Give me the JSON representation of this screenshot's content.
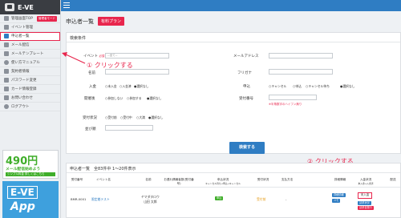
{
  "app": {
    "logo": "E-VE"
  },
  "sidebar": {
    "items": [
      {
        "label": "管理画面TOP",
        "badge": "管理者モード"
      },
      {
        "label": "イベント管理"
      },
      {
        "label": "申込者一覧"
      },
      {
        "label": "メール配信"
      },
      {
        "label": "メールテンプレート"
      },
      {
        "label": "使い方マニュアル"
      },
      {
        "label": "契約者情報"
      },
      {
        "label": "パスワード変更"
      },
      {
        "label": "カード情報登録"
      },
      {
        "label": "お問い合わせ"
      },
      {
        "label": "ログアウト"
      }
    ]
  },
  "ads": {
    "price": "490円",
    "price_sub": "メール配信始めよう",
    "price_strip": "シンプル料金 詳しくはこちら",
    "eve_text": "E-VE",
    "app_text": "App"
  },
  "page": {
    "title": "申込者一覧",
    "plan": "有料プラン"
  },
  "search": {
    "heading": "検索条件",
    "event_label": "イベント",
    "required": "必須",
    "event_value": "--全て--",
    "email_label": "メールアドレス",
    "name_label": "名前",
    "furigana_label": "フリガナ",
    "paid_label": "入金",
    "paid_opts": [
      "未入金",
      "入金済",
      "選択なし"
    ],
    "apply_label": "申込",
    "apply_opts": [
      "キャンセル",
      "申込",
      "キャンセル待ち",
      "選択なし"
    ],
    "attend_label": "開催後",
    "attend_opts": [
      "参加しない",
      "参加する",
      "選択なし"
    ],
    "receipt_label": "受付番号",
    "receipt_note": "※半角数字のハイフン無り",
    "status_label": "受付状況",
    "status_opts": [
      "受付前",
      "受付中",
      "大満",
      "選択なし"
    ],
    "sort_label": "並び順",
    "search_button": "検索する"
  },
  "annotations": {
    "first": "① クリックする",
    "second": "② クリックする"
  },
  "list": {
    "heading": "申込者一覧　全83件中 1〜20件表示",
    "columns": [
      "受付番号",
      "イベント名",
      "名前",
      "お連れ情報者数(受付番号)",
      "申込状況",
      "受付状況",
      "支払方法",
      "詳細情報",
      "入金状況",
      "配送"
    ],
    "col_sub_apply": "キャンセル待ち→申込→キャンセル",
    "col_sub_paid": "未入金→入金済",
    "rows": [
      {
        "id": "BMR-0001",
        "event": "限定着テスト",
        "name_kana": "ヤマダタロウ",
        "name": "山田 太郎",
        "apply": "申込",
        "status": "受付前",
        "payment": "-",
        "detail1": "詳細情報",
        "detail2": "メモ",
        "paid": "未入金",
        "paid2": "請求状況",
        "paid3": "請求書発行"
      }
    ]
  },
  "colors": {
    "accent": "#2f7dc3",
    "brand_red": "#e8264d"
  }
}
